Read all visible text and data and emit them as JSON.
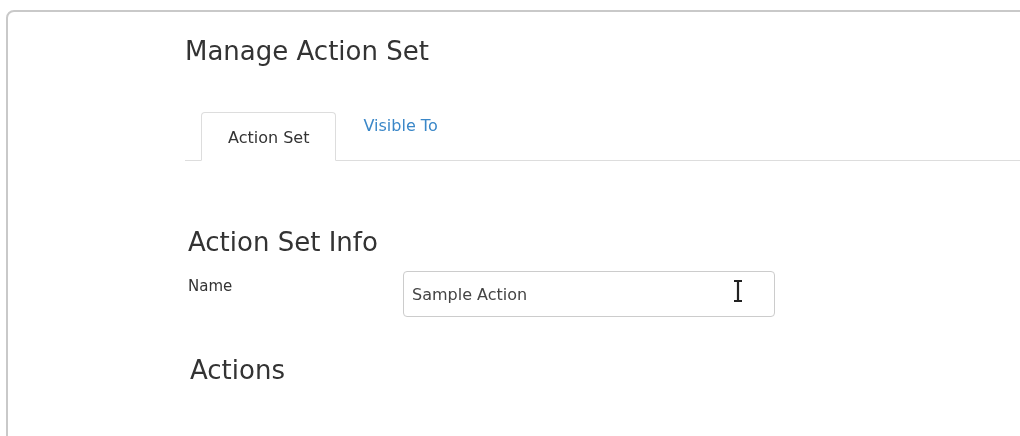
{
  "title": "Manage Action Set",
  "tabs": [
    {
      "label": "Action Set",
      "selected": true
    },
    {
      "label": "Visible To",
      "selected": false
    }
  ],
  "section_title": "Action Set Info",
  "name_field": {
    "label": "Name",
    "value": "Sample Action"
  },
  "actions_heading": "Actions"
}
